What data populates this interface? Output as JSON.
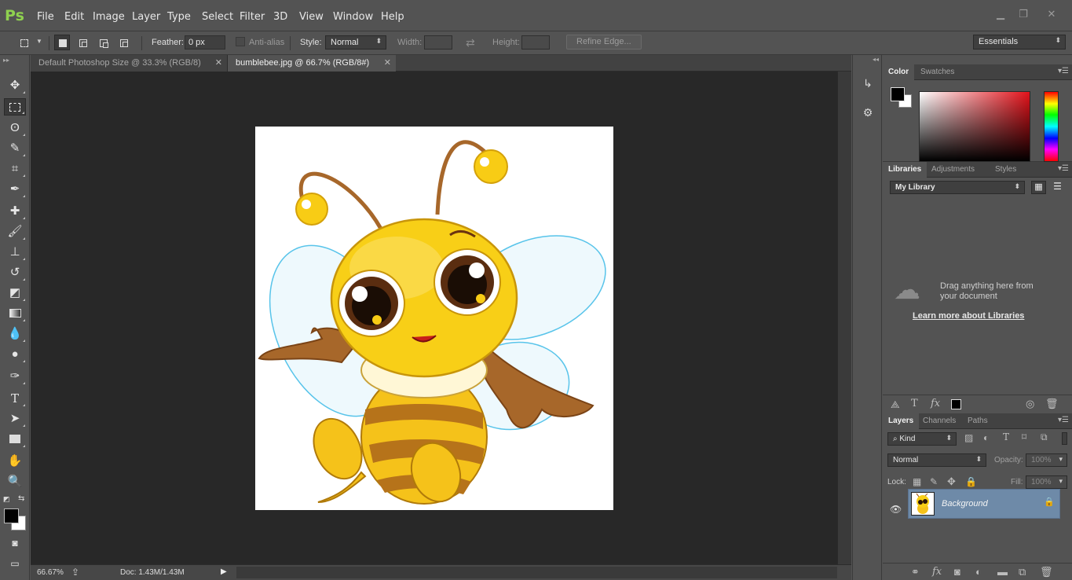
{
  "app": {
    "logo": "Ps"
  },
  "menu": [
    "File",
    "Edit",
    "Image",
    "Layer",
    "Type",
    "Select",
    "Filter",
    "3D",
    "View",
    "Window",
    "Help"
  ],
  "window_controls": {
    "minimize": "▁",
    "restore": "❐",
    "close": "✕"
  },
  "options": {
    "feather_label": "Feather:",
    "feather_value": "0 px",
    "antialias_label": "Anti-alias",
    "style_label": "Style:",
    "style_value": "Normal",
    "width_label": "Width:",
    "height_label": "Height:",
    "refine_edge": "Refine Edge...",
    "workspace": "Essentials"
  },
  "tabs": [
    {
      "label": "Default Photoshop Size @ 33.3% (RGB/8)",
      "active": false
    },
    {
      "label": "bumblebee.jpg @ 66.7% (RGB/8#)",
      "active": true
    }
  ],
  "status": {
    "zoom": "66.67%",
    "doc": "Doc: 1.43M/1.43M"
  },
  "color_panel": {
    "tabs": [
      "Color",
      "Swatches"
    ],
    "foreground": "#000000",
    "background": "#ffffff"
  },
  "libraries_panel": {
    "tabs": [
      "Libraries",
      "Adjustments",
      "Styles"
    ],
    "library_select": "My Library",
    "drag_hint": "Drag anything here from your document",
    "learn_more": "Learn more about Libraries"
  },
  "layers_panel": {
    "tabs": [
      "Layers",
      "Channels",
      "Paths"
    ],
    "kind_label": "Kind",
    "blend_mode": "Normal",
    "opacity_label": "Opacity:",
    "opacity_value": "100%",
    "lock_label": "Lock:",
    "fill_label": "Fill:",
    "fill_value": "100%",
    "layers": [
      {
        "name": "Background",
        "visible": true,
        "locked": true
      }
    ]
  },
  "colors": {
    "ps_green": "#8fd14f",
    "chrome": "#535353",
    "canvas": "#282828",
    "layer_selected": "#6e8aa8"
  }
}
